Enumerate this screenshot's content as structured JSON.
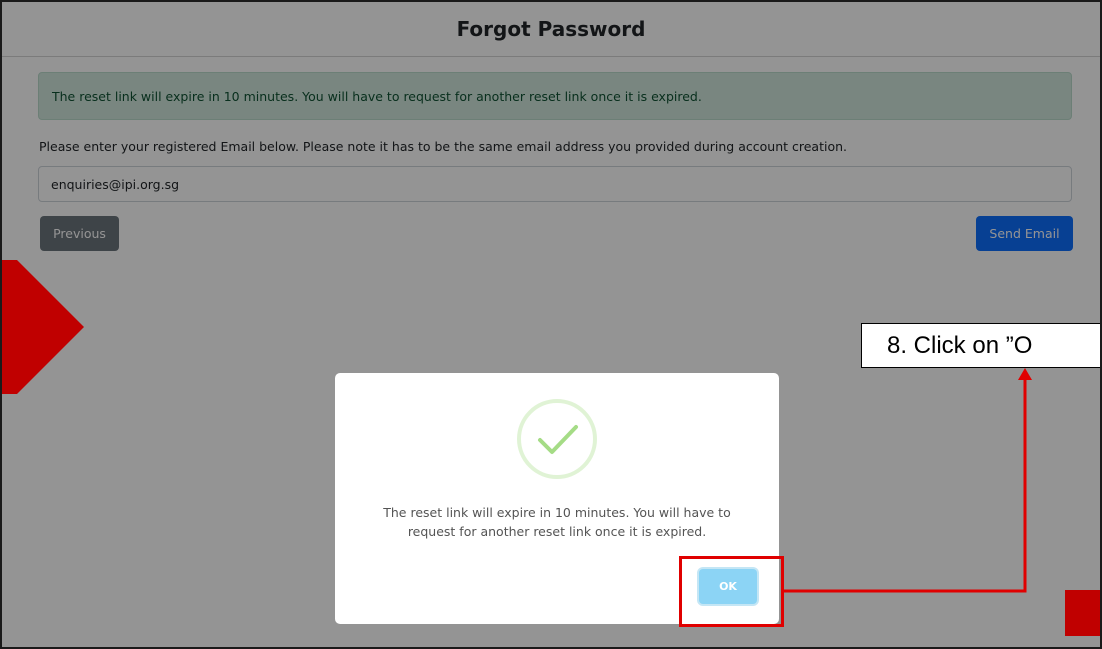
{
  "page": {
    "title": "Forgot Password",
    "alert_text": "The reset link will expire in 10 minutes. You will have to request for another reset link once it is expired.",
    "instructions": "Please enter your registered Email below. Please note it has to be the same email address you provided during account creation.",
    "email": {
      "value": "enquiries@ipi.org.sg",
      "placeholder": ""
    },
    "buttons": {
      "previous": "Previous",
      "send_email": "Send Email"
    }
  },
  "modal": {
    "icon": "success-check-icon",
    "message": "The reset link will expire in 10 minutes. You will have to request for another reset link once it is expired.",
    "ok_label": "OK"
  },
  "annotation": {
    "callout_text": "8. Click on ”O"
  },
  "colors": {
    "alert_bg": "#d1e7dd",
    "primary": "#0d6efd",
    "secondary": "#6c757d",
    "ok_button": "#8cd4f5",
    "annotation_red": "#e00000",
    "check_green": "#a5dc86"
  }
}
